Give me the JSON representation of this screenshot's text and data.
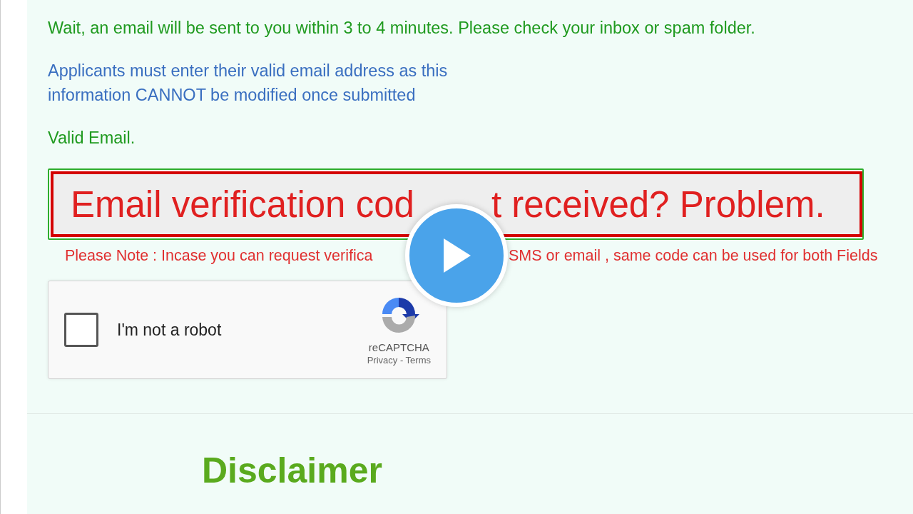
{
  "messages": [
    {
      "kind": "success",
      "text": "Wait, an email will be sent to you within 3 to 4 minutes. Please check your inbox or spam folder."
    },
    {
      "kind": "info",
      "text": "Applicants must enter their valid email address as this information CANNOT be modified once submitted"
    },
    {
      "kind": "success",
      "text": "Valid Email."
    }
  ],
  "email_field": {
    "valid": true
  },
  "video_overlay": {
    "title": [
      "Email verification cod",
      "t received? Problem."
    ]
  },
  "note": [
    "Please Note : Incase you can request verifica",
    "SMS or email , same code can be used for both Fields"
  ],
  "captcha": {
    "label": "I'm not a robot",
    "checked": false,
    "brand": "reCAPTCHA",
    "links": "Privacy - Terms"
  },
  "heading": "Disclaimer"
}
